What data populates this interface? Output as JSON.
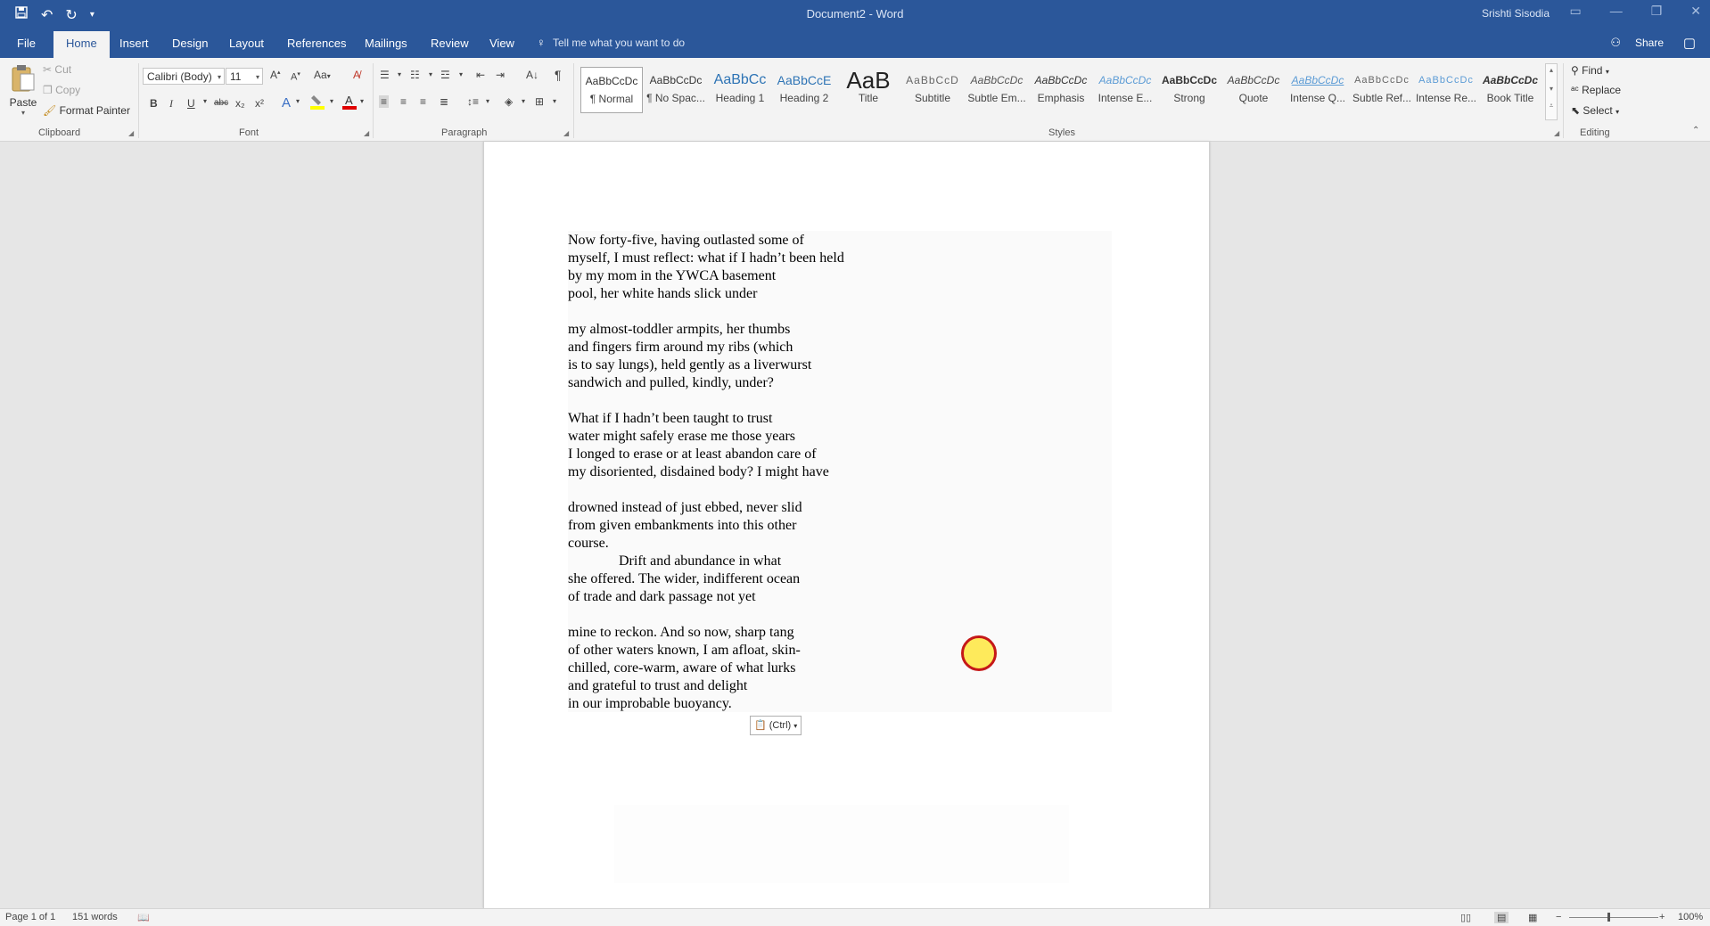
{
  "window": {
    "title": "Document2  -  Word",
    "user": "Srishti Sisodia"
  },
  "qat": {
    "save_icon": "save-icon",
    "undo_icon": "undo-icon",
    "redo_icon": "redo-icon",
    "customize_icon": "customize-qat-icon"
  },
  "tabs": [
    "File",
    "Home",
    "Insert",
    "Design",
    "Layout",
    "References",
    "Mailings",
    "Review",
    "View"
  ],
  "active_tab": "Home",
  "tell_me": "Tell me what you want to do",
  "share": "Share",
  "clipboard": {
    "paste": "Paste",
    "cut": "Cut",
    "copy": "Copy",
    "format_painter": "Format Painter",
    "group": "Clipboard"
  },
  "font": {
    "name": "Calibri (Body)",
    "size": "11",
    "change_case": "Aa",
    "bold": "B",
    "italic": "I",
    "underline": "U",
    "strike": "abc",
    "subscript": "x₂",
    "superscript": "x²",
    "group": "Font"
  },
  "paragraph": {
    "group": "Paragraph"
  },
  "styles": {
    "group": "Styles",
    "items": [
      {
        "preview": "AaBbCcDc",
        "label": "¶ Normal"
      },
      {
        "preview": "AaBbCcDc",
        "label": "¶ No Spac..."
      },
      {
        "preview": "AaBbCc",
        "label": "Heading 1"
      },
      {
        "preview": "AaBbCcE",
        "label": "Heading 2"
      },
      {
        "preview": "AaB",
        "label": "Title"
      },
      {
        "preview": "AaBbCcD",
        "label": "Subtitle"
      },
      {
        "preview": "AaBbCcDc",
        "label": "Subtle Em..."
      },
      {
        "preview": "AaBbCcDc",
        "label": "Emphasis"
      },
      {
        "preview": "AaBbCcDc",
        "label": "Intense E..."
      },
      {
        "preview": "AaBbCcDc",
        "label": "Strong"
      },
      {
        "preview": "AaBbCcDc",
        "label": "Quote"
      },
      {
        "preview": "AaBbCcDc",
        "label": "Intense Q..."
      },
      {
        "preview": "AaBbCcDc",
        "label": "Subtle Ref..."
      },
      {
        "preview": "AaBbCcDc",
        "label": "Intense Re..."
      },
      {
        "preview": "AaBbCcDc",
        "label": "Book Title"
      }
    ]
  },
  "editing": {
    "group": "Editing",
    "find": "Find",
    "replace": "Replace",
    "select": "Select"
  },
  "poem": [
    "Now forty-five, having outlasted some of",
    "myself, I must reflect: what if I hadn’t been held",
    "by my mom in the YWCA basement",
    "pool, her white hands slick under",
    "",
    "my almost-toddler armpits, her thumbs",
    "and fingers firm around my ribs (which",
    "is to say lungs), held gently as a liverwurst",
    "sandwich and pulled, kindly, under?",
    "",
    "What if I hadn’t been taught to trust",
    "water might safely erase me those years",
    "I longed to erase or at least abandon care of",
    "my disoriented, disdained body? I might have",
    "",
    "drowned instead of just ebbed, never slid",
    "from given embankments into this other",
    "course.",
    "Drift and abundance in what",
    "she offered. The wider, indifferent ocean",
    "of trade and dark passage not yet",
    "",
    "mine to reckon. And so now, sharp tang",
    "of other waters known, I am afloat, skin-",
    "chilled, core-warm, aware of what lurks",
    "and grateful to trust and delight",
    "in our improbable buoyancy."
  ],
  "paste_options": "(Ctrl)",
  "status": {
    "page": "Page 1 of 1",
    "words": "151 words",
    "zoom": "100%"
  }
}
